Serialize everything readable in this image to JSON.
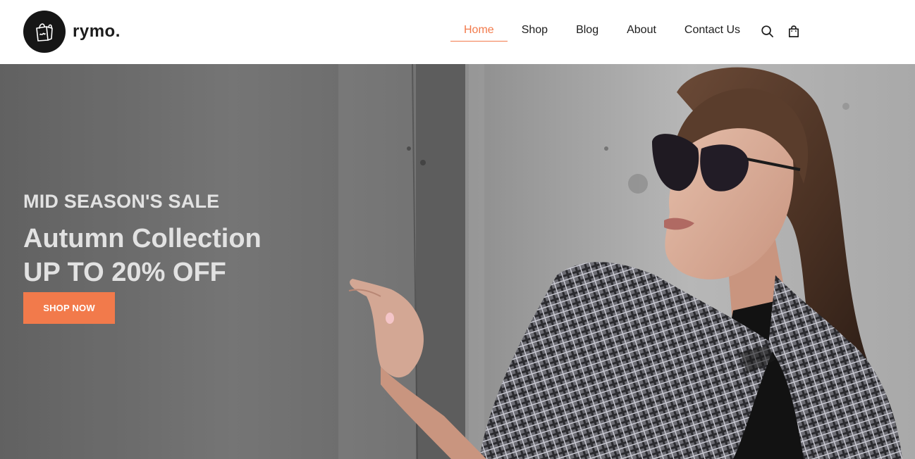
{
  "brand": {
    "name": "rymo.",
    "logo_icon": "shopping-bag-icon"
  },
  "nav": {
    "items": [
      {
        "label": "Home",
        "active": true
      },
      {
        "label": "Shop",
        "active": false
      },
      {
        "label": "Blog",
        "active": false
      },
      {
        "label": "About",
        "active": false
      },
      {
        "label": "Contact Us",
        "active": false
      }
    ],
    "icons": [
      "search-icon",
      "cart-icon"
    ]
  },
  "hero": {
    "kicker": "MID SEASON'S SALE",
    "headline_line1": "Autumn Collection",
    "headline_line2": "UP TO 20% OFF",
    "cta_label": "SHOP NOW",
    "image": "woman-in-sunglasses-plaid-coat-against-concrete-wall"
  },
  "colors": {
    "accent": "#f27a4b",
    "logo_bg": "#161616",
    "hero_text": "#e2e2e2",
    "nav_text": "#1d1d1d"
  }
}
